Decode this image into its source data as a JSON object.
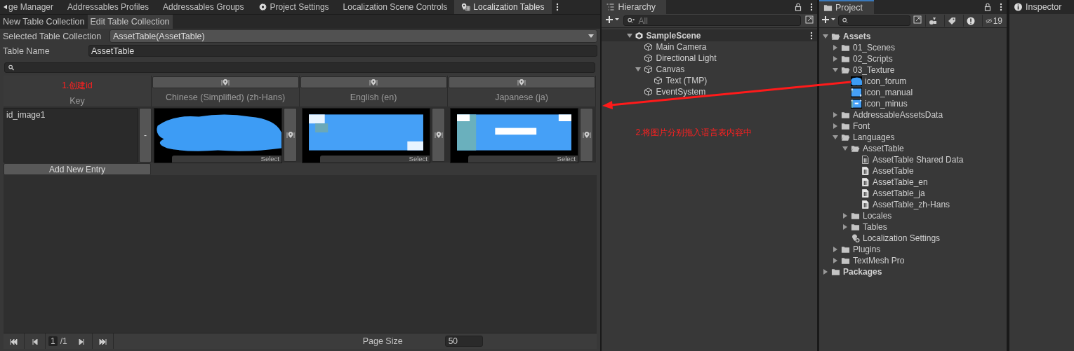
{
  "editor_tabs": [
    {
      "label": "ge Manager",
      "selected": false,
      "kind": "plain"
    },
    {
      "label": "Addressables Profiles",
      "selected": false,
      "kind": "plain"
    },
    {
      "label": "Addressables Groups",
      "selected": false,
      "kind": "plain"
    },
    {
      "label": "Project Settings",
      "selected": false,
      "kind": "settings"
    },
    {
      "label": "Localization Scene Controls",
      "selected": false,
      "kind": "plain"
    },
    {
      "label": "Localization Tables",
      "selected": true,
      "kind": "localization"
    }
  ],
  "sub_tabs": [
    {
      "label": "New Table Collection",
      "selected": false
    },
    {
      "label": "Edit Table Collection",
      "selected": true
    }
  ],
  "selected_table_collection": {
    "label": "Selected Table Collection",
    "value": "AssetTable(AssetTable)"
  },
  "table_name": {
    "label": "Table Name",
    "value": "AssetTable"
  },
  "table": {
    "key_header": "Key",
    "key_annotation": "1.创建id",
    "columns": [
      "Chinese (Simplified) (zh-Hans)",
      "English (en)",
      "Japanese (ja)"
    ],
    "rows": [
      {
        "key": "id_image1",
        "remove": "-",
        "cells": [
          {
            "kind": "bubble",
            "select": "Select"
          },
          {
            "kind": "panel",
            "select": "Select"
          },
          {
            "kind": "minus",
            "select": "Select"
          }
        ]
      }
    ],
    "add_button": "Add New Entry"
  },
  "pager": {
    "page": "1",
    "total": "/1",
    "page_size_label": "Page Size",
    "page_size": "50"
  },
  "hierarchy": {
    "title": "Hierarchy",
    "search_placeholder": "All",
    "scene": {
      "label": "SampleScene",
      "expanded": true,
      "children": [
        {
          "label": "Main Camera"
        },
        {
          "label": "Directional Light"
        },
        {
          "label": "Canvas",
          "expanded": true,
          "children": [
            {
              "label": "Text (TMP)"
            }
          ]
        },
        {
          "label": "EventSystem"
        }
      ]
    },
    "annotation": "2.将图片分别拖入语言表内容中"
  },
  "project": {
    "title": "Project",
    "hidden_count": "19",
    "tree": [
      {
        "label": "Assets",
        "kind": "folder",
        "expanded": true,
        "bold": true,
        "children": [
          {
            "label": "01_Scenes",
            "kind": "folder",
            "expanded": false
          },
          {
            "label": "02_Scripts",
            "kind": "folder",
            "expanded": false
          },
          {
            "label": "03_Texture",
            "kind": "folder",
            "expanded": true,
            "children": [
              {
                "label": "icon_forum",
                "kind": "bubble-texture"
              },
              {
                "label": "icon_manual",
                "kind": "panel-texture"
              },
              {
                "label": "icon_minus",
                "kind": "minus-texture"
              }
            ]
          },
          {
            "label": "AddressableAssetsData",
            "kind": "folder",
            "expanded": false
          },
          {
            "label": "Font",
            "kind": "folder",
            "expanded": false
          },
          {
            "label": "Languages",
            "kind": "folder",
            "expanded": true,
            "children": [
              {
                "label": "AssetTable",
                "kind": "folder",
                "expanded": true,
                "children": [
                  {
                    "label": "AssetTable Shared Data",
                    "kind": "shared-table"
                  },
                  {
                    "label": "AssetTable",
                    "kind": "table"
                  },
                  {
                    "label": "AssetTable_en",
                    "kind": "table"
                  },
                  {
                    "label": "AssetTable_ja",
                    "kind": "table"
                  },
                  {
                    "label": "AssetTable_zh-Hans",
                    "kind": "table"
                  }
                ]
              },
              {
                "label": "Locales",
                "kind": "folder",
                "expanded": false
              },
              {
                "label": "Tables",
                "kind": "folder",
                "expanded": false
              },
              {
                "label": "Localization Settings",
                "kind": "settings"
              }
            ]
          },
          {
            "label": "Plugins",
            "kind": "folder",
            "expanded": false
          },
          {
            "label": "TextMesh Pro",
            "kind": "folder",
            "expanded": false
          }
        ]
      },
      {
        "label": "Packages",
        "kind": "folder",
        "expanded": false,
        "bold": true
      }
    ]
  },
  "inspector": {
    "title": "Inspector"
  }
}
